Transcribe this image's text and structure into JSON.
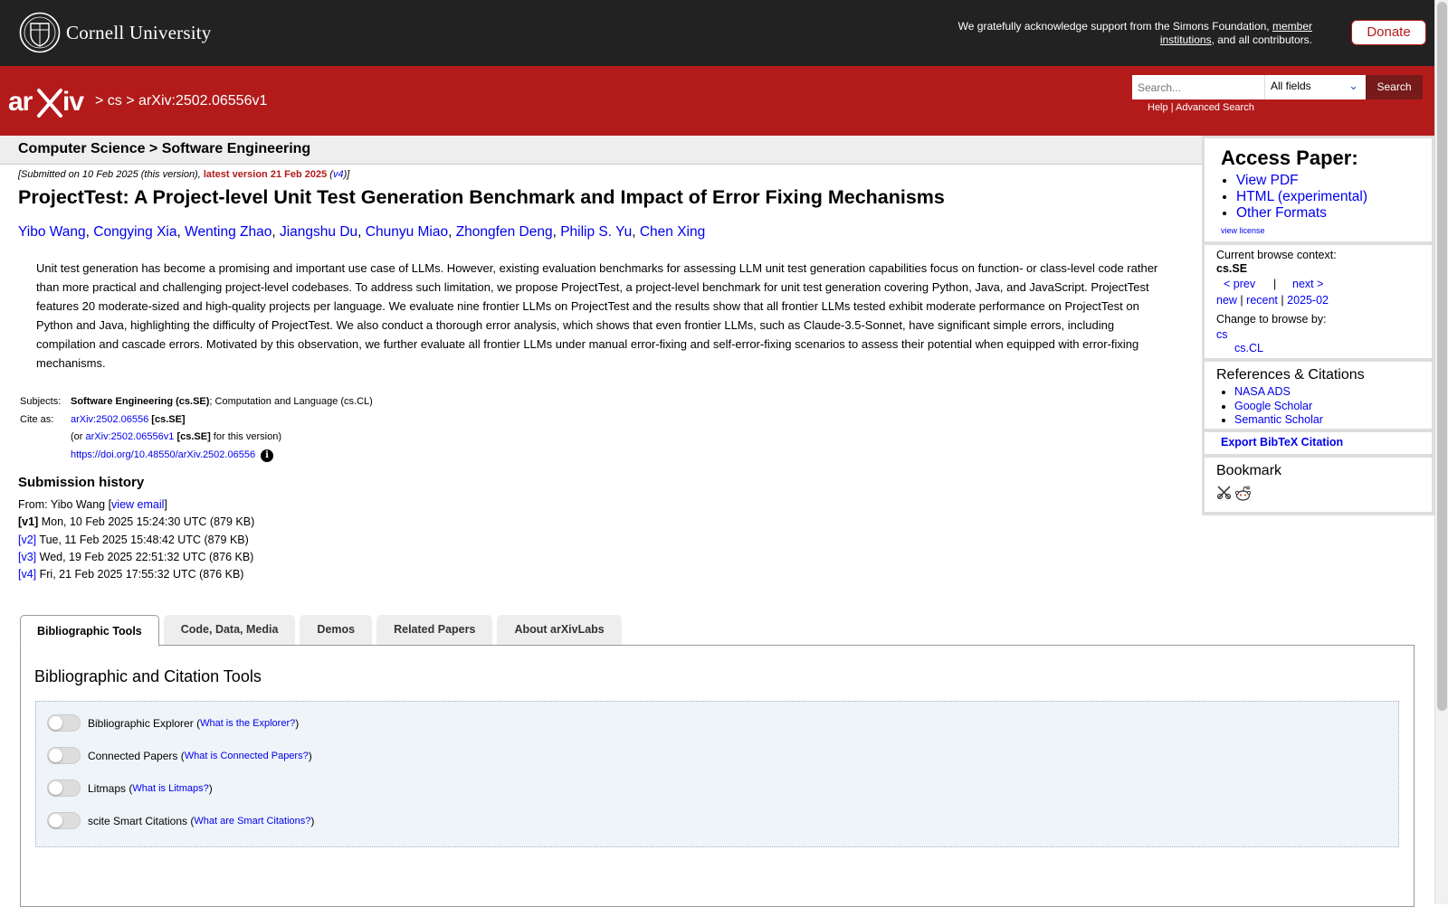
{
  "topbar": {
    "logo_text": "Cornell University",
    "support_text": "We gratefully acknowledge support from the Simons Foundation,",
    "support_link": "member institutions",
    "support_tail": ", and all contributors.",
    "donate_label": "Donate"
  },
  "header": {
    "breadcrumb_sep": ">",
    "breadcrumb_cs": "cs",
    "breadcrumb_id": "arXiv:2502.06556v1",
    "search_placeholder": "Search...",
    "field_select": "All fields",
    "search_button": "Search",
    "help_link": "Help",
    "help_sep": "|",
    "advanced_link": "Advanced Search"
  },
  "subheader": {
    "title": "Computer Science > Software Engineering"
  },
  "paper": {
    "dateline_prefix": "[Submitted on 10 Feb 2025 (this version), ",
    "dateline_latest": "latest version 21 Feb 2025",
    "dateline_open": " (",
    "dateline_version": "v4",
    "dateline_close": ")]",
    "title": "ProjectTest: A Project-level Unit Test Generation Benchmark and Impact of Error Fixing Mechanisms",
    "authors": [
      "Yibo Wang",
      "Congying Xia",
      "Wenting Zhao",
      "Jiangshu Du",
      "Chunyu Miao",
      "Zhongfen Deng",
      "Philip S. Yu",
      "Chen Xing"
    ],
    "abstract": "Unit test generation has become a promising and important use case of LLMs. However, existing evaluation benchmarks for assessing LLM unit test generation capabilities focus on function- or class-level code rather than more practical and challenging project-level codebases. To address such limitation, we propose ProjectTest, a project-level benchmark for unit test generation covering Python, Java, and JavaScript. ProjectTest features 20 moderate-sized and high-quality projects per language. We evaluate nine frontier LLMs on ProjectTest and the results show that all frontier LLMs tested exhibit moderate performance on ProjectTest on Python and Java, highlighting the difficulty of ProjectTest. We also conduct a thorough error analysis, which shows that even frontier LLMs, such as Claude-3.5-Sonnet, have significant simple errors, including compilation and cascade errors. Motivated by this observation, we further evaluate all frontier LLMs under manual error-fixing and self-error-fixing scenarios to assess their potential when equipped with error-fixing mechanisms.",
    "subjects_label": "Subjects:",
    "subjects_primary": "Software Engineering (cs.SE)",
    "subjects_rest": "; Computation and Language (cs.CL)",
    "cite_label": "Cite as:",
    "cite_id": "arXiv:2502.06556",
    "cite_cat": "[cs.SE]",
    "cite_or": "(or",
    "cite_version_id": "arXiv:2502.06556v1",
    "cite_version_cat": "[cs.SE]",
    "cite_version_tail": "for this version)",
    "doi": "https://doi.org/10.48550/arXiv.2502.06556",
    "info_icon": "i"
  },
  "history": {
    "heading": "Submission history",
    "from_prefix": "From: Yibo Wang [",
    "from_link": "view email",
    "from_suffix": "]",
    "versions": [
      {
        "tag": "[v1]",
        "date": " Mon, 10 Feb 2025 15:24:30 UTC (879 KB)"
      },
      {
        "tag": "[v2]",
        "date": " Tue, 11 Feb 2025 15:48:42 UTC (879 KB)"
      },
      {
        "tag": "[v3]",
        "date": " Wed, 19 Feb 2025 22:51:32 UTC (876 KB)"
      },
      {
        "tag": "[v4]",
        "date": " Fri, 21 Feb 2025 17:55:32 UTC (876 KB)"
      }
    ]
  },
  "tabs": [
    "Bibliographic Tools",
    "Code, Data, Media",
    "Demos",
    "Related Papers",
    "About arXivLabs"
  ],
  "panel": {
    "heading": "Bibliographic and Citation Tools",
    "toggles": [
      {
        "label": "Bibliographic Explorer",
        "link": "What is the Explorer?"
      },
      {
        "label": "Connected Papers",
        "link": "What is Connected Papers?"
      },
      {
        "label": "Litmaps",
        "link": "What is Litmaps?"
      },
      {
        "label": "scite Smart Citations",
        "link": "What are Smart Citations?"
      }
    ]
  },
  "sidebar": {
    "access_heading": "Access Paper:",
    "access_links": [
      "View PDF",
      "HTML (experimental)",
      "Other Formats"
    ],
    "view_license": "view license",
    "browse_context_label": "Current browse context:",
    "browse_context": "cs.SE",
    "prev": "< prev",
    "bar": "|",
    "next": "next >",
    "new": "new",
    "recent": "recent",
    "month": "2025-02",
    "change_label": "Change to browse by:",
    "browse_cs": "cs",
    "browse_cscl": "cs.CL",
    "refs_heading": "References & Citations",
    "refs": [
      "NASA ADS",
      "Google Scholar",
      "Semantic Scholar"
    ],
    "export": "Export BibTeX Citation",
    "bookmark_heading": "Bookmark"
  },
  "colors": {
    "brand_red": "#b31b1b",
    "dark_bar": "#222222",
    "link": "#0000ee"
  }
}
